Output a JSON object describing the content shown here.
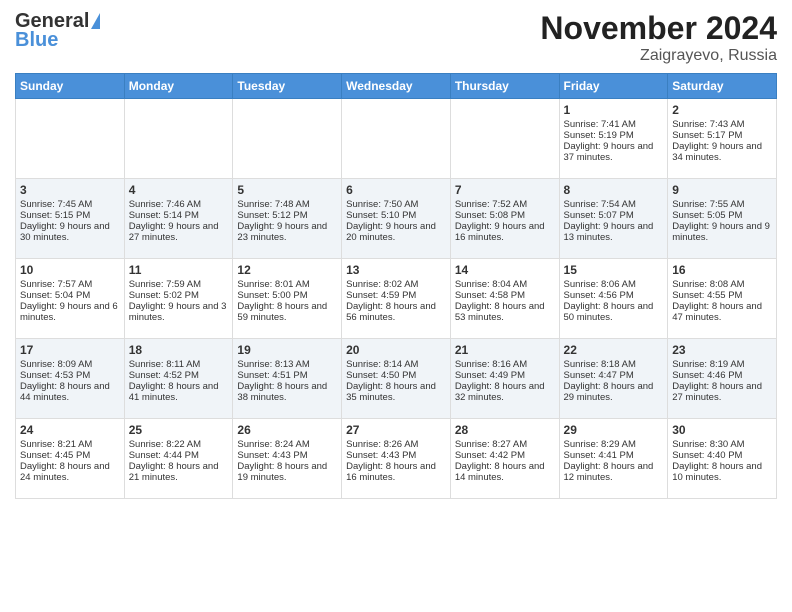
{
  "header": {
    "logo_general": "General",
    "logo_blue": "Blue",
    "month_title": "November 2024",
    "location": "Zaigrayevo, Russia"
  },
  "weekdays": [
    "Sunday",
    "Monday",
    "Tuesday",
    "Wednesday",
    "Thursday",
    "Friday",
    "Saturday"
  ],
  "weeks": [
    [
      {
        "day": "",
        "sunrise": "",
        "sunset": "",
        "daylight": ""
      },
      {
        "day": "",
        "sunrise": "",
        "sunset": "",
        "daylight": ""
      },
      {
        "day": "",
        "sunrise": "",
        "sunset": "",
        "daylight": ""
      },
      {
        "day": "",
        "sunrise": "",
        "sunset": "",
        "daylight": ""
      },
      {
        "day": "",
        "sunrise": "",
        "sunset": "",
        "daylight": ""
      },
      {
        "day": "1",
        "sunrise": "Sunrise: 7:41 AM",
        "sunset": "Sunset: 5:19 PM",
        "daylight": "Daylight: 9 hours and 37 minutes."
      },
      {
        "day": "2",
        "sunrise": "Sunrise: 7:43 AM",
        "sunset": "Sunset: 5:17 PM",
        "daylight": "Daylight: 9 hours and 34 minutes."
      }
    ],
    [
      {
        "day": "3",
        "sunrise": "Sunrise: 7:45 AM",
        "sunset": "Sunset: 5:15 PM",
        "daylight": "Daylight: 9 hours and 30 minutes."
      },
      {
        "day": "4",
        "sunrise": "Sunrise: 7:46 AM",
        "sunset": "Sunset: 5:14 PM",
        "daylight": "Daylight: 9 hours and 27 minutes."
      },
      {
        "day": "5",
        "sunrise": "Sunrise: 7:48 AM",
        "sunset": "Sunset: 5:12 PM",
        "daylight": "Daylight: 9 hours and 23 minutes."
      },
      {
        "day": "6",
        "sunrise": "Sunrise: 7:50 AM",
        "sunset": "Sunset: 5:10 PM",
        "daylight": "Daylight: 9 hours and 20 minutes."
      },
      {
        "day": "7",
        "sunrise": "Sunrise: 7:52 AM",
        "sunset": "Sunset: 5:08 PM",
        "daylight": "Daylight: 9 hours and 16 minutes."
      },
      {
        "day": "8",
        "sunrise": "Sunrise: 7:54 AM",
        "sunset": "Sunset: 5:07 PM",
        "daylight": "Daylight: 9 hours and 13 minutes."
      },
      {
        "day": "9",
        "sunrise": "Sunrise: 7:55 AM",
        "sunset": "Sunset: 5:05 PM",
        "daylight": "Daylight: 9 hours and 9 minutes."
      }
    ],
    [
      {
        "day": "10",
        "sunrise": "Sunrise: 7:57 AM",
        "sunset": "Sunset: 5:04 PM",
        "daylight": "Daylight: 9 hours and 6 minutes."
      },
      {
        "day": "11",
        "sunrise": "Sunrise: 7:59 AM",
        "sunset": "Sunset: 5:02 PM",
        "daylight": "Daylight: 9 hours and 3 minutes."
      },
      {
        "day": "12",
        "sunrise": "Sunrise: 8:01 AM",
        "sunset": "Sunset: 5:00 PM",
        "daylight": "Daylight: 8 hours and 59 minutes."
      },
      {
        "day": "13",
        "sunrise": "Sunrise: 8:02 AM",
        "sunset": "Sunset: 4:59 PM",
        "daylight": "Daylight: 8 hours and 56 minutes."
      },
      {
        "day": "14",
        "sunrise": "Sunrise: 8:04 AM",
        "sunset": "Sunset: 4:58 PM",
        "daylight": "Daylight: 8 hours and 53 minutes."
      },
      {
        "day": "15",
        "sunrise": "Sunrise: 8:06 AM",
        "sunset": "Sunset: 4:56 PM",
        "daylight": "Daylight: 8 hours and 50 minutes."
      },
      {
        "day": "16",
        "sunrise": "Sunrise: 8:08 AM",
        "sunset": "Sunset: 4:55 PM",
        "daylight": "Daylight: 8 hours and 47 minutes."
      }
    ],
    [
      {
        "day": "17",
        "sunrise": "Sunrise: 8:09 AM",
        "sunset": "Sunset: 4:53 PM",
        "daylight": "Daylight: 8 hours and 44 minutes."
      },
      {
        "day": "18",
        "sunrise": "Sunrise: 8:11 AM",
        "sunset": "Sunset: 4:52 PM",
        "daylight": "Daylight: 8 hours and 41 minutes."
      },
      {
        "day": "19",
        "sunrise": "Sunrise: 8:13 AM",
        "sunset": "Sunset: 4:51 PM",
        "daylight": "Daylight: 8 hours and 38 minutes."
      },
      {
        "day": "20",
        "sunrise": "Sunrise: 8:14 AM",
        "sunset": "Sunset: 4:50 PM",
        "daylight": "Daylight: 8 hours and 35 minutes."
      },
      {
        "day": "21",
        "sunrise": "Sunrise: 8:16 AM",
        "sunset": "Sunset: 4:49 PM",
        "daylight": "Daylight: 8 hours and 32 minutes."
      },
      {
        "day": "22",
        "sunrise": "Sunrise: 8:18 AM",
        "sunset": "Sunset: 4:47 PM",
        "daylight": "Daylight: 8 hours and 29 minutes."
      },
      {
        "day": "23",
        "sunrise": "Sunrise: 8:19 AM",
        "sunset": "Sunset: 4:46 PM",
        "daylight": "Daylight: 8 hours and 27 minutes."
      }
    ],
    [
      {
        "day": "24",
        "sunrise": "Sunrise: 8:21 AM",
        "sunset": "Sunset: 4:45 PM",
        "daylight": "Daylight: 8 hours and 24 minutes."
      },
      {
        "day": "25",
        "sunrise": "Sunrise: 8:22 AM",
        "sunset": "Sunset: 4:44 PM",
        "daylight": "Daylight: 8 hours and 21 minutes."
      },
      {
        "day": "26",
        "sunrise": "Sunrise: 8:24 AM",
        "sunset": "Sunset: 4:43 PM",
        "daylight": "Daylight: 8 hours and 19 minutes."
      },
      {
        "day": "27",
        "sunrise": "Sunrise: 8:26 AM",
        "sunset": "Sunset: 4:43 PM",
        "daylight": "Daylight: 8 hours and 16 minutes."
      },
      {
        "day": "28",
        "sunrise": "Sunrise: 8:27 AM",
        "sunset": "Sunset: 4:42 PM",
        "daylight": "Daylight: 8 hours and 14 minutes."
      },
      {
        "day": "29",
        "sunrise": "Sunrise: 8:29 AM",
        "sunset": "Sunset: 4:41 PM",
        "daylight": "Daylight: 8 hours and 12 minutes."
      },
      {
        "day": "30",
        "sunrise": "Sunrise: 8:30 AM",
        "sunset": "Sunset: 4:40 PM",
        "daylight": "Daylight: 8 hours and 10 minutes."
      }
    ]
  ]
}
